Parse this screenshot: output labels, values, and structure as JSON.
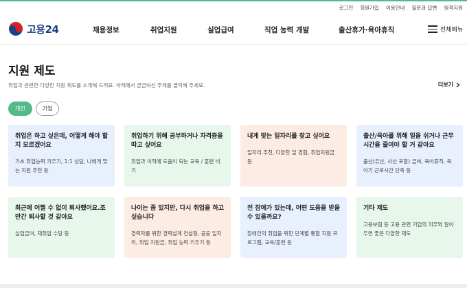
{
  "colors": {
    "accent": "#55b98a",
    "brand": "#1d3f84",
    "blue": "#e8f0fd",
    "green": "#e7f7ec",
    "orange": "#fdece3"
  },
  "utility_links": [
    "로그인",
    "회원가입",
    "이용안내",
    "질문과 답변",
    "원격지원"
  ],
  "logo": {
    "text": "고용24",
    "icon": "korea-taegeuk-icon"
  },
  "nav": {
    "items": [
      "채용정보",
      "취업지원",
      "실업급여",
      "직업 능력 개발",
      "출산휴가·육아휴직"
    ],
    "all_menu": "전체메뉴"
  },
  "page": {
    "title": "지원 제도",
    "description": "취업과 관련한 다양한 지원 제도를 소개해 드려요. 아래에서 궁금하신 주제를 클릭해 주세요.",
    "more": "더보기"
  },
  "tabs": [
    {
      "label": "개인",
      "active": true
    },
    {
      "label": "기업",
      "active": false
    }
  ],
  "cards": [
    {
      "title": "취업은 하고 싶은데, 어떻게 해야 할지 모르겠어요",
      "desc": "기초 취업능력 키우기, 1:1 상담, 나에게 맞는 지원 추천 등",
      "color": "#e8f0fd"
    },
    {
      "title": "취업하기 위해 공부하거나 자격증을 따고 싶어요",
      "desc": "취업과 이직에 도움이 되는 교육 / 훈련 비기",
      "color": "#e7f7ec"
    },
    {
      "title": "내게 맞는 일자리를 찾고 싶어요",
      "desc": "일자리 추천, 다양한 일 경험, 취업지원금 등",
      "color": "#fdece3"
    },
    {
      "title": "출산/육아를 위해 일을 쉬거나 근무시간을 줄여야 할 거 같아요",
      "desc": "출산(유산, 사산 포함) 급여, 육아휴직, 육아기 근로시간 단축 등",
      "color": "#e8f0fd"
    },
    {
      "title": "최근에 어쩔 수 없이 퇴사했어요.조만간 퇴사할 것 같아요",
      "desc": "실업급여, 재취업 수당 등",
      "color": "#e7f7ec"
    },
    {
      "title": "나이는 좀 있지만, 다시 취업을 하고 싶습니다",
      "desc": "경력자를 위한 경력설계 컨설팅, 공공 일자리, 취업 지원금, 취업 능력 키우기 등",
      "color": "#fdece3"
    },
    {
      "title": "전 장애가 있는데, 어떤 도움을 받을 수 있을까요?",
      "desc": "장애인의 취업을 위한 단계별 통합 지원 프로그램, 교육/훈련 등",
      "color": "#e8f0fd"
    },
    {
      "title": "기타 제도",
      "desc": "고용보험 등 고용 관련 기업의 의무와 알아두면 좋은 다양한 제도",
      "color": "#e7f7ec"
    }
  ]
}
